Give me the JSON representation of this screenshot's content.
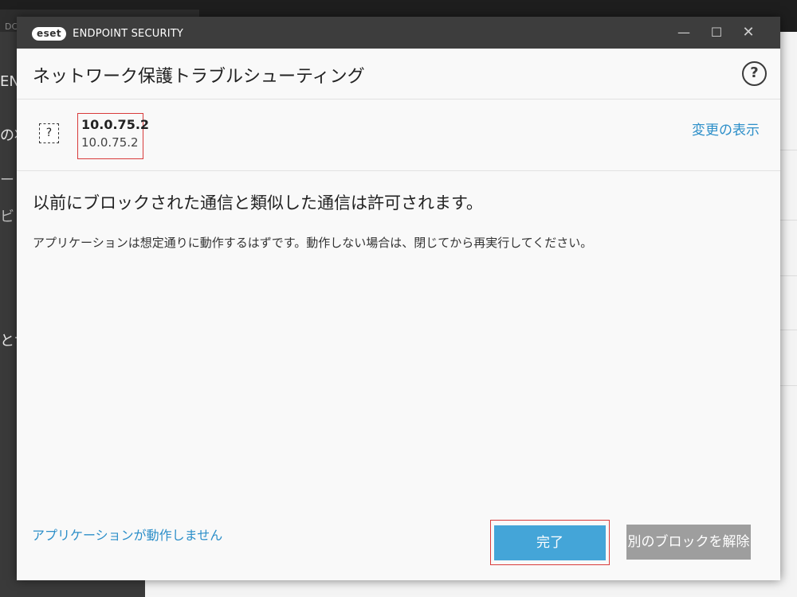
{
  "background": {
    "tab_label": "DC",
    "sidebar_fragments": [
      "EN",
      "の状",
      "ー",
      "ビ",
      "とサ"
    ]
  },
  "window": {
    "logo": "eset",
    "product": "ENDPOINT SECURITY",
    "minimize": "—",
    "maximize": "☐",
    "close": "✕"
  },
  "header": {
    "title": "ネットワーク保護トラブルシューティング",
    "help_icon": "?"
  },
  "application": {
    "icon": "?",
    "name": "10.0.75.2",
    "address": "10.0.75.2",
    "show_changes": "変更の表示"
  },
  "message": {
    "title": "以前にブロックされた通信と類似した通信は許可されます。",
    "body": "アプリケーションは想定通りに動作するはずです。動作しない場合は、閉じてから再実行してください。"
  },
  "footer": {
    "app_not_working": "アプリケーションが動作しません",
    "done": "完了",
    "unblock_another": "別のブロックを解除"
  },
  "colors": {
    "link": "#2d8fc9",
    "primary_button": "#44a5d8",
    "secondary_button": "#9e9e9e",
    "highlight_border": "#d83b3b",
    "titlebar": "#3d3d3d"
  }
}
